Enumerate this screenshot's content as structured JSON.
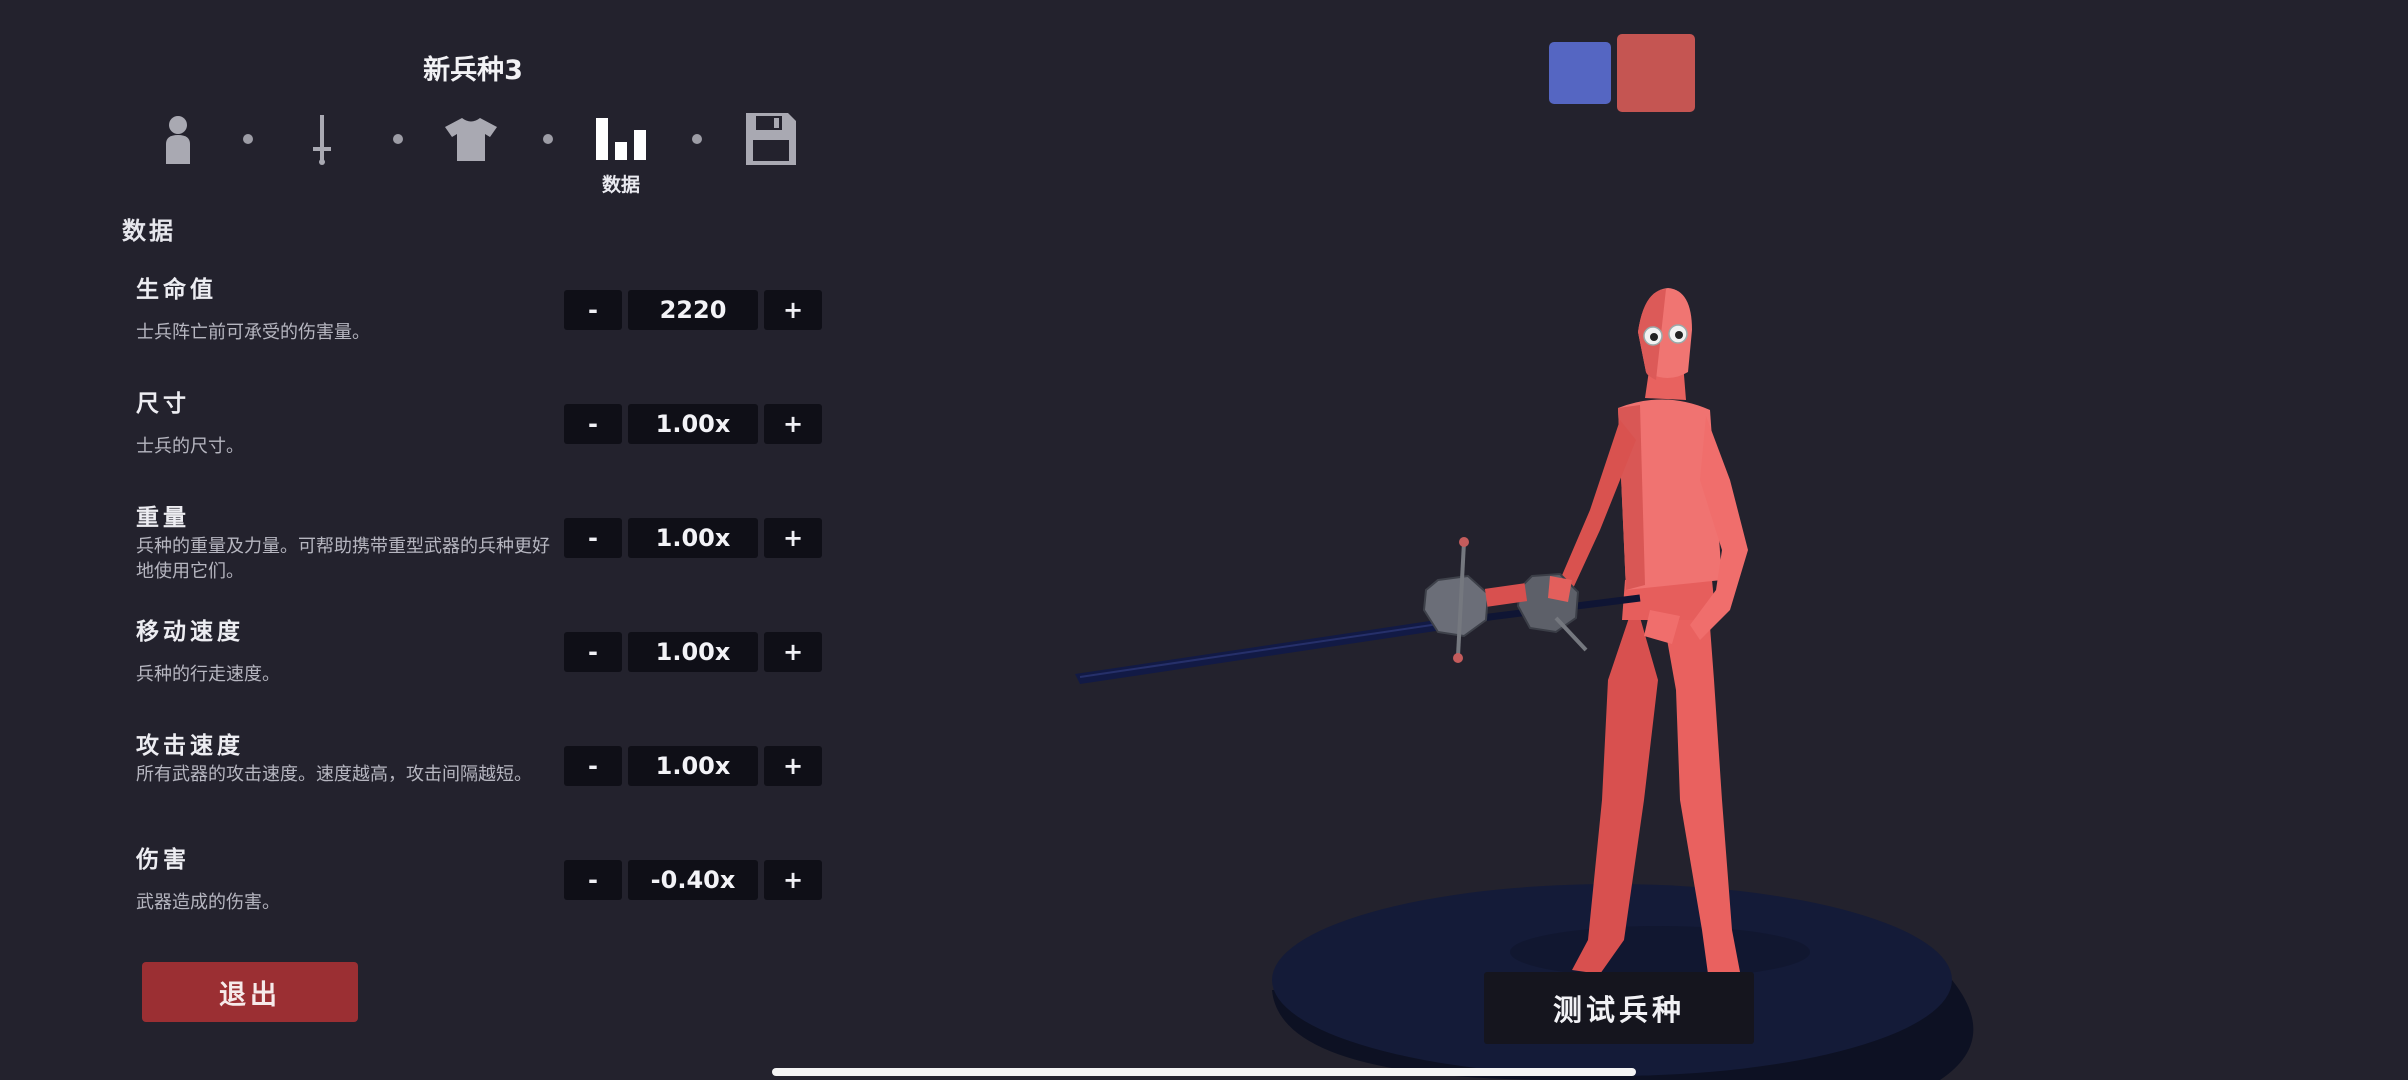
{
  "unit": {
    "title": "新兵种3"
  },
  "steps": [
    {
      "icon": "person-icon",
      "label": ""
    },
    {
      "icon": "sword-icon",
      "label": ""
    },
    {
      "icon": "shirt-icon",
      "label": ""
    },
    {
      "icon": "bar-chart-icon",
      "label": "数据",
      "active": true
    },
    {
      "icon": "save-icon",
      "label": ""
    }
  ],
  "section": {
    "title": "数据"
  },
  "stats": [
    {
      "name": "生命值",
      "desc": "士兵阵亡前可承受的伤害量。",
      "value": "2220",
      "minus": "-",
      "plus": "+"
    },
    {
      "name": "尺寸",
      "desc": "士兵的尺寸。",
      "value": "1.00x",
      "minus": "-",
      "plus": "+"
    },
    {
      "name": "重量",
      "desc": "兵种的重量及力量。可帮助携带重型武器的兵种更好地使用它们。",
      "value": "1.00x",
      "minus": "-",
      "plus": "+"
    },
    {
      "name": "移动速度",
      "desc": "兵种的行走速度。",
      "value": "1.00x",
      "minus": "-",
      "plus": "+"
    },
    {
      "name": "攻击速度",
      "desc": "所有武器的攻击速度。速度越高，攻击间隔越短。",
      "value": "1.00x",
      "minus": "-",
      "plus": "+"
    },
    {
      "name": "伤害",
      "desc": "武器造成的伤害。",
      "value": "-0.40x",
      "minus": "-",
      "plus": "+"
    }
  ],
  "buttons": {
    "exit": "退出",
    "test": "测试兵种"
  },
  "teams": {
    "blue": "#5566c2",
    "red": "#c55552",
    "selected": "red"
  },
  "colors": {
    "background": "#23222d",
    "control": "#0f0f17",
    "exit": "#9b2f33",
    "unit_body": "#ee6a67"
  }
}
